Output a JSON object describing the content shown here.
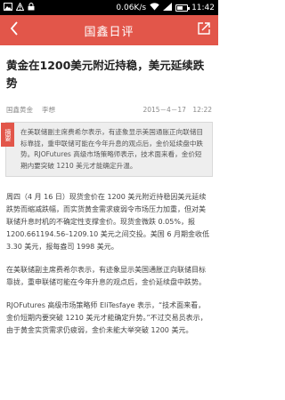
{
  "status": {
    "left_icons": "notifications",
    "speed": "0.06K/s",
    "time": "11:42"
  },
  "appbar": {
    "title": "国鑫日评"
  },
  "article": {
    "headline": "黄金在1200美元附近持稳，美元延续跌势",
    "source": "国鑫黄金",
    "author": "李想",
    "datetime": "2015－4－17　12:22",
    "summary_tag": "摘要",
    "summary": "在美联储副主席费希尔表示，有迹象显示美国通胀正向联储目标靠拢，重申联储可能在今年升息的观点后，金价延续盘中跌势。RJOFutures 高级市场策略师表示，技术面来看，金价短期内要突破 1210 美元才能确定升温。",
    "paragraphs": [
      "周四（4 月 16 日）现货金价在 1200 美元附近持稳因美元延续跌势而缩减跌幅，而实货黄金需求疲弱令市场压力加重，但对美联储升息时机的不确定性支撑金价。现货金微跌 0.05%，报 1200.661194.56–1209.10 美元之间交投。美国 6 月期金收低 3.30 美元，报每盎司 1998 美元。",
      "在美联储副主席费希尔表示，有迹象显示美国通胀正向联储目标靠拢，重申联储可能在今年升息的观点后，金价延续盘中跌势。",
      "RJOFutures 高级市场策略师 EliTesfaye 表示，“技术面来看，金价短期内要突破 1210 美元才能确定升势。”不过交易员表示，由于黄金实货需求仍疲弱，金价未能大举突破 1200 美元。"
    ]
  }
}
